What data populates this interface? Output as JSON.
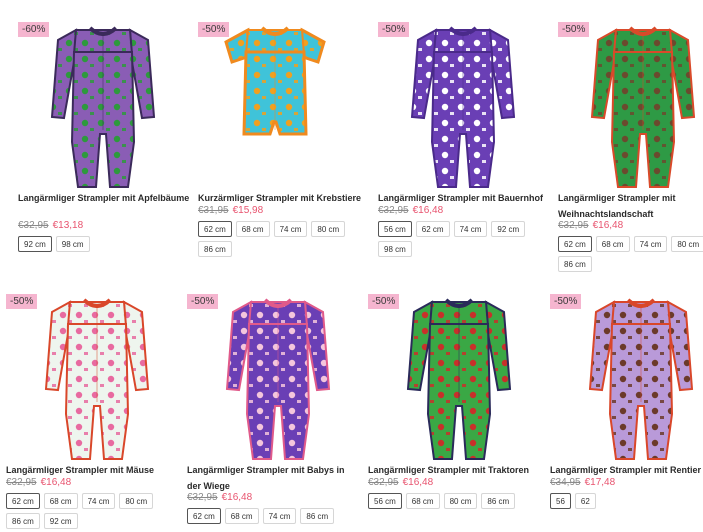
{
  "products": [
    {
      "badge": "-60%",
      "title": "Langärmliger Strampler mit Apfelbäume",
      "old_price": "€32,95",
      "new_price": "€13,18",
      "sizes": [
        "92 cm",
        "98 cm"
      ],
      "selected_size": "92 cm",
      "image": "romper-apple-trees",
      "colors": {
        "body": "#8a5db5",
        "pattern": "#2d9a3c",
        "trim": "#3b2a5a"
      }
    },
    {
      "badge": "-50%",
      "title": "Kurzärmliger Strampler mit Krebstiere",
      "old_price": "€31,95",
      "new_price": "€15,98",
      "sizes": [
        "62 cm",
        "68 cm",
        "74 cm",
        "80 cm",
        "86 cm"
      ],
      "selected_size": "62 cm",
      "image": "romper-crustaceans",
      "colors": {
        "body": "#3fc3d9",
        "pattern": "#f0a020",
        "trim": "#f08a1e"
      }
    },
    {
      "badge": "-50%",
      "title": "Langärmliger Strampler mit Bauernhof",
      "old_price": "€32,95",
      "new_price": "€16,48",
      "sizes": [
        "56 cm",
        "62 cm",
        "74 cm",
        "92 cm",
        "98 cm"
      ],
      "selected_size": "56 cm",
      "image": "romper-farm",
      "colors": {
        "body": "#6a3fb5",
        "pattern": "#ffffff",
        "trim": "#4a2a8a"
      }
    },
    {
      "badge": "-50%",
      "title": "Langärmliger Strampler mit Weihnachtslandschaft",
      "old_price": "€32,95",
      "new_price": "€16,48",
      "sizes": [
        "62 cm",
        "68 cm",
        "74 cm",
        "80 cm",
        "86 cm"
      ],
      "selected_size": "62 cm",
      "image": "romper-christmas-landscape",
      "colors": {
        "body": "#2e9a45",
        "pattern": "#6b4a2e",
        "trim": "#d94a2a"
      }
    },
    {
      "badge": "-50%",
      "title": "Langärmliger Strampler mit Mäuse",
      "old_price": "€32,95",
      "new_price": "€16,48",
      "sizes": [
        "62 cm",
        "68 cm",
        "74 cm",
        "80 cm",
        "86 cm",
        "92 cm"
      ],
      "selected_size": "62 cm",
      "image": "romper-mice",
      "colors": {
        "body": "#eef5ee",
        "pattern": "#e86aa0",
        "trim": "#d9472a"
      }
    },
    {
      "badge": "-50%",
      "title": "Langärmliger Strampler mit Babys in der Wiege",
      "old_price": "€32,95",
      "new_price": "€16,48",
      "sizes": [
        "62 cm",
        "68 cm",
        "74 cm",
        "86 cm"
      ],
      "selected_size": "62 cm",
      "image": "romper-babies-cradle",
      "colors": {
        "body": "#6a3fb5",
        "pattern": "#f4c6dc",
        "trim": "#e05a8a"
      }
    },
    {
      "badge": "-50%",
      "title": "Langärmliger Strampler mit Traktoren",
      "old_price": "€32,95",
      "new_price": "€16,48",
      "sizes": [
        "56 cm",
        "68 cm",
        "80 cm",
        "86 cm"
      ],
      "selected_size": "56 cm",
      "image": "romper-tractors",
      "colors": {
        "body": "#3aa845",
        "pattern": "#c8302a",
        "trim": "#2a2a5a"
      }
    },
    {
      "badge": "-50%",
      "title": "Langärmliger Strampler mit Rentier",
      "old_price": "€34,95",
      "new_price": "€17,48",
      "sizes": [
        "56",
        "62"
      ],
      "selected_size": "56",
      "image": "romper-reindeer",
      "colors": {
        "body": "#b99ad9",
        "pattern": "#6b3a2a",
        "trim": "#d9472a"
      }
    }
  ]
}
